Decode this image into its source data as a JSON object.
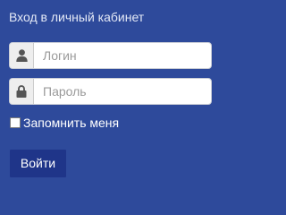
{
  "login_form": {
    "title": "Вход в личный кабинет",
    "login": {
      "icon": "user-icon",
      "placeholder": "Логин",
      "value": ""
    },
    "password": {
      "icon": "lock-icon",
      "placeholder": "Пароль",
      "value": ""
    },
    "remember_me": {
      "label": "Запомнить меня",
      "checked": false
    },
    "submit_label": "Войти"
  },
  "colors": {
    "background": "#2e4a9b",
    "button": "#1f3589",
    "addon": "#eeeeee",
    "icon": "#555555"
  }
}
